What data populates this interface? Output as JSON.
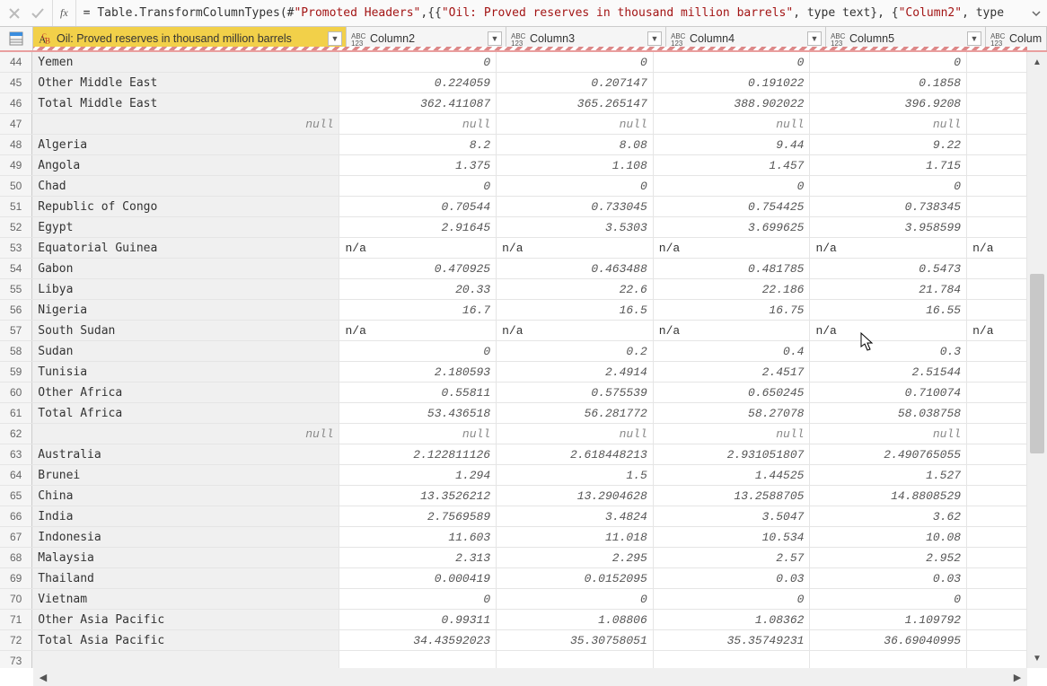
{
  "formula": {
    "fx": "fx",
    "prefix": "= Table.TransformColumnTypes(#",
    "promoted": "\"Promoted Headers\"",
    "mid": ",{{",
    "col1": "\"Oil: Proved reserves in thousand million barrels\"",
    "mid2": ", type text}, {",
    "col2": "\"Column2\"",
    "tail": ", type"
  },
  "columns": {
    "widths": {
      "rownum": 37,
      "c1": 349,
      "c2": 178,
      "c3": 178,
      "c4": 178,
      "c5": 178,
      "c6": 68
    },
    "headers": {
      "c1": "Oil: Proved reserves in thousand million barrels",
      "c2": "Column2",
      "c3": "Column3",
      "c4": "Column4",
      "c5": "Column5",
      "c6": "Colum"
    }
  },
  "rows": [
    {
      "n": 44,
      "name": "Yemen",
      "v": [
        "0",
        "0",
        "0",
        "0",
        ""
      ]
    },
    {
      "n": 45,
      "name": "Other Middle East",
      "v": [
        "0.224059",
        "0.207147",
        "0.191022",
        "0.1858",
        ""
      ]
    },
    {
      "n": 46,
      "name": "Total Middle East",
      "v": [
        "362.411087",
        "365.265147",
        "388.902022",
        "396.9208",
        ""
      ]
    },
    {
      "n": 47,
      "name": "",
      "null": true,
      "v": [
        "null",
        "null",
        "null",
        "null",
        ""
      ]
    },
    {
      "n": 48,
      "name": "Algeria",
      "v": [
        "8.2",
        "8.08",
        "9.44",
        "9.22",
        ""
      ]
    },
    {
      "n": 49,
      "name": "Angola",
      "v": [
        "1.375",
        "1.108",
        "1.457",
        "1.715",
        ""
      ]
    },
    {
      "n": 50,
      "name": "Chad",
      "v": [
        "0",
        "0",
        "0",
        "0",
        ""
      ]
    },
    {
      "n": 51,
      "name": "Republic of Congo",
      "v": [
        "0.70544",
        "0.733045",
        "0.754425",
        "0.738345",
        ""
      ]
    },
    {
      "n": 52,
      "name": "Egypt",
      "v": [
        "2.91645",
        "3.5303",
        "3.699625",
        "3.958599",
        ""
      ]
    },
    {
      "n": 53,
      "name": "Equatorial Guinea",
      "na": true,
      "v": [
        "n/a",
        "n/a",
        "n/a",
        "n/a",
        "n/a"
      ]
    },
    {
      "n": 54,
      "name": "Gabon",
      "v": [
        "0.470925",
        "0.463488",
        "0.481785",
        "0.5473",
        ""
      ]
    },
    {
      "n": 55,
      "name": "Libya",
      "v": [
        "20.33",
        "22.6",
        "22.186",
        "21.784",
        ""
      ]
    },
    {
      "n": 56,
      "name": "Nigeria",
      "v": [
        "16.7",
        "16.5",
        "16.75",
        "16.55",
        ""
      ]
    },
    {
      "n": 57,
      "name": "South Sudan",
      "na": true,
      "v": [
        "n/a",
        "n/a",
        "n/a",
        "n/a",
        "n/a"
      ]
    },
    {
      "n": 58,
      "name": "Sudan",
      "v": [
        "0",
        "0.2",
        "0.4",
        "0.3",
        ""
      ]
    },
    {
      "n": 59,
      "name": "Tunisia",
      "v": [
        "2.180593",
        "2.4914",
        "2.4517",
        "2.51544",
        ""
      ]
    },
    {
      "n": 60,
      "name": "Other Africa",
      "v": [
        "0.55811",
        "0.575539",
        "0.650245",
        "0.710074",
        ""
      ]
    },
    {
      "n": 61,
      "name": "Total Africa",
      "v": [
        "53.436518",
        "56.281772",
        "58.27078",
        "58.038758",
        ""
      ]
    },
    {
      "n": 62,
      "name": "",
      "null": true,
      "v": [
        "null",
        "null",
        "null",
        "null",
        ""
      ]
    },
    {
      "n": 63,
      "name": "Australia",
      "v": [
        "2.122811126",
        "2.618448213",
        "2.931051807",
        "2.490765055",
        ""
      ]
    },
    {
      "n": 64,
      "name": "Brunei",
      "v": [
        "1.294",
        "1.5",
        "1.44525",
        "1.527",
        ""
      ]
    },
    {
      "n": 65,
      "name": "China",
      "v": [
        "13.3526212",
        "13.2904628",
        "13.2588705",
        "14.8808529",
        ""
      ]
    },
    {
      "n": 66,
      "name": "India",
      "v": [
        "2.7569589",
        "3.4824",
        "3.5047",
        "3.62",
        ""
      ]
    },
    {
      "n": 67,
      "name": "Indonesia",
      "v": [
        "11.603",
        "11.018",
        "10.534",
        "10.08",
        ""
      ]
    },
    {
      "n": 68,
      "name": "Malaysia",
      "v": [
        "2.313",
        "2.295",
        "2.57",
        "2.952",
        ""
      ]
    },
    {
      "n": 69,
      "name": "Thailand",
      "v": [
        "0.000419",
        "0.0152095",
        "0.03",
        "0.03",
        ""
      ]
    },
    {
      "n": 70,
      "name": "Vietnam",
      "v": [
        "0",
        "0",
        "0",
        "0",
        ""
      ]
    },
    {
      "n": 71,
      "name": "Other Asia Pacific",
      "v": [
        "0.99311",
        "1.08806",
        "1.08362",
        "1.109792",
        ""
      ]
    },
    {
      "n": 72,
      "name": "Total Asia Pacific",
      "v": [
        "34.43592023",
        "35.30758051",
        "35.35749231",
        "36.69040995",
        ""
      ]
    },
    {
      "n": 73,
      "name": "",
      "v": [
        "",
        "",
        "",
        "",
        ""
      ]
    }
  ]
}
